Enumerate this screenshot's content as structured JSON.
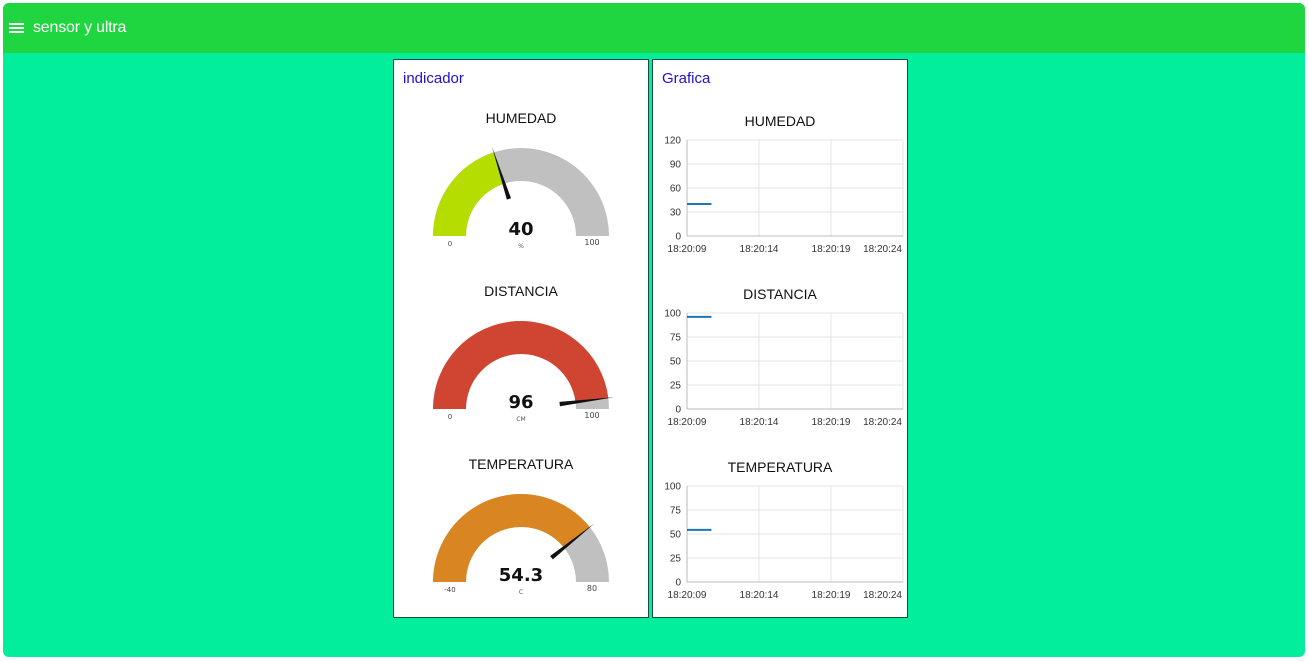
{
  "app": {
    "title": "sensor y ultra",
    "menu_icon": "hamburger-menu-icon"
  },
  "colors": {
    "toolbar": "#1fd641",
    "background": "#02ee9d",
    "card_title": "#1f10d6",
    "gauge_track": "#c0c0c0",
    "line": "#1f77b4"
  },
  "indicador": {
    "title": "indicador",
    "gauges": [
      {
        "title": "HUMEDAD",
        "value": 40,
        "value_label": "40",
        "min": 0,
        "max": 100,
        "min_label": "0",
        "max_label": "100",
        "unit": "%",
        "color": "#b6dd00"
      },
      {
        "title": "DISTANCIA",
        "value": 96,
        "value_label": "96",
        "min": 0,
        "max": 100,
        "min_label": "0",
        "max_label": "100",
        "unit": "CM",
        "color": "#cf4532"
      },
      {
        "title": "TEMPERATURA",
        "value": 54.3,
        "value_label": "54.3",
        "min": -40,
        "max": 80,
        "min_label": "-40",
        "max_label": "80",
        "unit": "C",
        "color": "#d98622"
      }
    ]
  },
  "grafica": {
    "title": "Grafica",
    "charts": [
      {
        "title": "HUMEDAD",
        "y_ticks": [
          "120",
          "90",
          "60",
          "30",
          "0"
        ],
        "ylim": [
          0,
          120
        ]
      },
      {
        "title": "DISTANCIA",
        "y_ticks": [
          "100",
          "75",
          "50",
          "25",
          "0"
        ],
        "ylim": [
          0,
          100
        ]
      },
      {
        "title": "TEMPERATURA",
        "y_ticks": [
          "100",
          "75",
          "50",
          "25",
          "0"
        ],
        "ylim": [
          0,
          100
        ]
      }
    ]
  },
  "chart_data": [
    {
      "type": "line",
      "title": "HUMEDAD",
      "x": [
        "18:20:09",
        "18:20:14",
        "18:20:19",
        "18:20:24"
      ],
      "x_ticks": [
        "18:20:09",
        "18:20:14",
        "18:20:19",
        "18:20:24"
      ],
      "series": [
        {
          "x": [
            "18:20:09",
            "18:20:10.7"
          ],
          "values": [
            40,
            40
          ]
        }
      ],
      "ylim": [
        0,
        120
      ],
      "grid": true
    },
    {
      "type": "line",
      "title": "DISTANCIA",
      "x": [
        "18:20:09",
        "18:20:14",
        "18:20:19",
        "18:20:24"
      ],
      "x_ticks": [
        "18:20:09",
        "18:20:14",
        "18:20:19",
        "18:20:24"
      ],
      "series": [
        {
          "x": [
            "18:20:09",
            "18:20:10.7"
          ],
          "values": [
            96,
            96
          ]
        }
      ],
      "ylim": [
        0,
        100
      ],
      "grid": true
    },
    {
      "type": "line",
      "title": "TEMPERATURA",
      "x": [
        "18:20:09",
        "18:20:14",
        "18:20:19",
        "18:20:24"
      ],
      "x_ticks": [
        "18:20:09",
        "18:20:14",
        "18:20:19",
        "18:20:24"
      ],
      "series": [
        {
          "x": [
            "18:20:09",
            "18:20:10.7"
          ],
          "values": [
            54.3,
            54.3
          ]
        }
      ],
      "ylim": [
        0,
        100
      ],
      "grid": true
    }
  ]
}
